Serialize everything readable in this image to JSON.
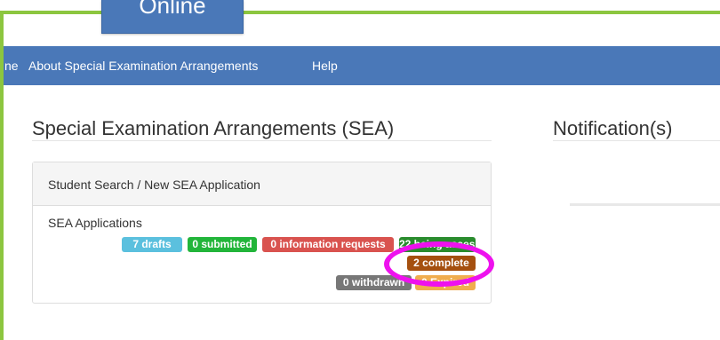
{
  "logo": {
    "text": "Online"
  },
  "nav": {
    "home": "ne",
    "about": "About Special Examination Arrangements",
    "help": "Help"
  },
  "main": {
    "heading": "Special Examination Arrangements (SEA)"
  },
  "notifications": {
    "heading": "Notification(s)"
  },
  "panel": {
    "header": "Student Search / New SEA Application",
    "label": "SEA Applications",
    "badges": {
      "drafts": "7 drafts",
      "submitted": "0 submitted",
      "information_requests": "0 information requests",
      "being_assessed": "22 being assessed",
      "complete": "2 complete",
      "withdrawn": "0 withdrawn",
      "expired": "0 Expired"
    }
  },
  "colors": {
    "frame": "#8cc63f",
    "navbar": "#4a78b8",
    "drafts": "#5bc0de",
    "submitted": "#22b53a",
    "information_requests": "#d9534f",
    "being_assessed": "#2a8c2e",
    "complete": "#a5500f",
    "withdrawn": "#777777",
    "expired": "#f0ad4e",
    "highlight": "#ee11ee"
  }
}
